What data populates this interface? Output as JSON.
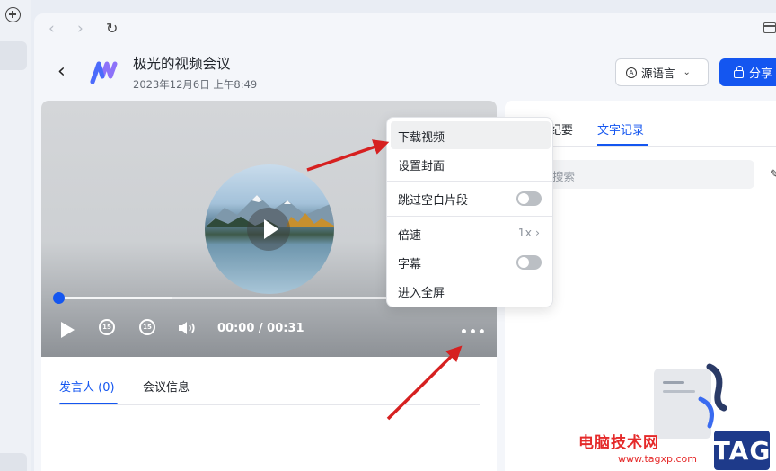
{
  "nav": {
    "back_glyph": "‹",
    "forward_glyph": "›",
    "reload_glyph": "↻"
  },
  "header": {
    "back_glyph": "‹",
    "title": "极光的视频会议",
    "datetime": "2023年12月6日 上午8:49",
    "lang_button_label": "源语言",
    "lang_icon_glyph": "A",
    "lang_chevron": "⌄",
    "share_button_label": "分享"
  },
  "player": {
    "time": "00:00 / 00:31",
    "rewind_label": "15",
    "forward_label": "15",
    "more_glyph": "•••",
    "progress_fraction": 0
  },
  "left_tabs": {
    "speakers": "发言人 (0)",
    "meeting_info": "会议信息"
  },
  "right_tabs": {
    "summary": "纪要",
    "transcript": "文字记录"
  },
  "search": {
    "placeholder": "搜索"
  },
  "edit_glyph": "✎",
  "context_menu": {
    "download": "下载视频",
    "set_cover": "设置封面",
    "skip_blank": "跳过空白片段",
    "speed": "倍速",
    "speed_value": "1x ›",
    "subtitles": "字幕",
    "fullscreen": "进入全屏"
  },
  "watermark": {
    "site_name": "电脑技术网",
    "url": "www.tagxp.com",
    "badge": "TAG"
  },
  "colors": {
    "accent": "#1456f0",
    "annotation_arrow": "#d62020"
  }
}
